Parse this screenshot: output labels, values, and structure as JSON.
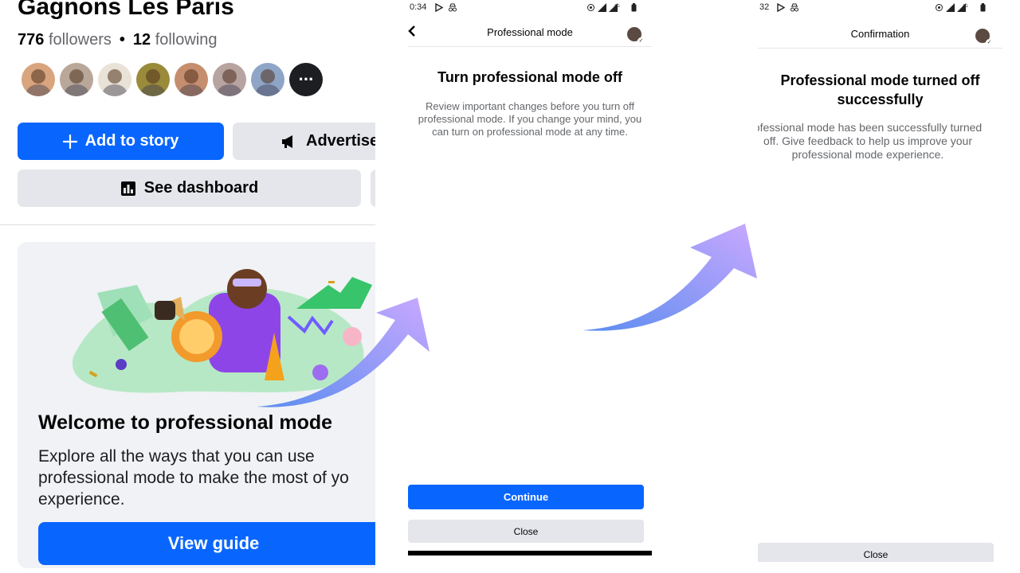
{
  "panel1": {
    "page_name": "Gagnons Les Paris",
    "followers_count": "776",
    "followers_label": "followers",
    "following_count": "12",
    "following_label": "following",
    "avatar_colors": [
      "#d8a57e",
      "#b9a89a",
      "#e9e2d6",
      "#9a8b3a",
      "#c58e6e",
      "#b7a3a0",
      "#8ea5c7"
    ],
    "add_to_story_label": "Add to story",
    "advertise_label": "Advertise",
    "see_dashboard_label": "See dashboard",
    "card_title": "Welcome to professional mode",
    "card_description": "Explore all the ways that you can use\nprofessional mode to make the most of yo\nexperience.",
    "view_guide_label": "View guide"
  },
  "panel2": {
    "status_time": "0:34",
    "screen_title": "Professional mode",
    "heading": "Turn professional mode off",
    "body": "Review important changes before you turn off\nprofessional mode. If you change your mind, you\ncan turn on professional mode at any time.",
    "continue_label": "Continue",
    "close_label": "Close"
  },
  "panel3": {
    "status_time": "32",
    "screen_title": "Confirmation",
    "heading": "Professional mode turned off\nsuccessfully",
    "body": "ofessional mode has been successfully turned\noff. Give feedback to help us improve your\nprofessional mode experience.",
    "close_label": "Close"
  },
  "colors": {
    "facebook_blue": "#0866ff",
    "button_gray": "#e4e6eb",
    "arrow_start": "#5b8def",
    "arrow_end": "#c9a8ff"
  }
}
